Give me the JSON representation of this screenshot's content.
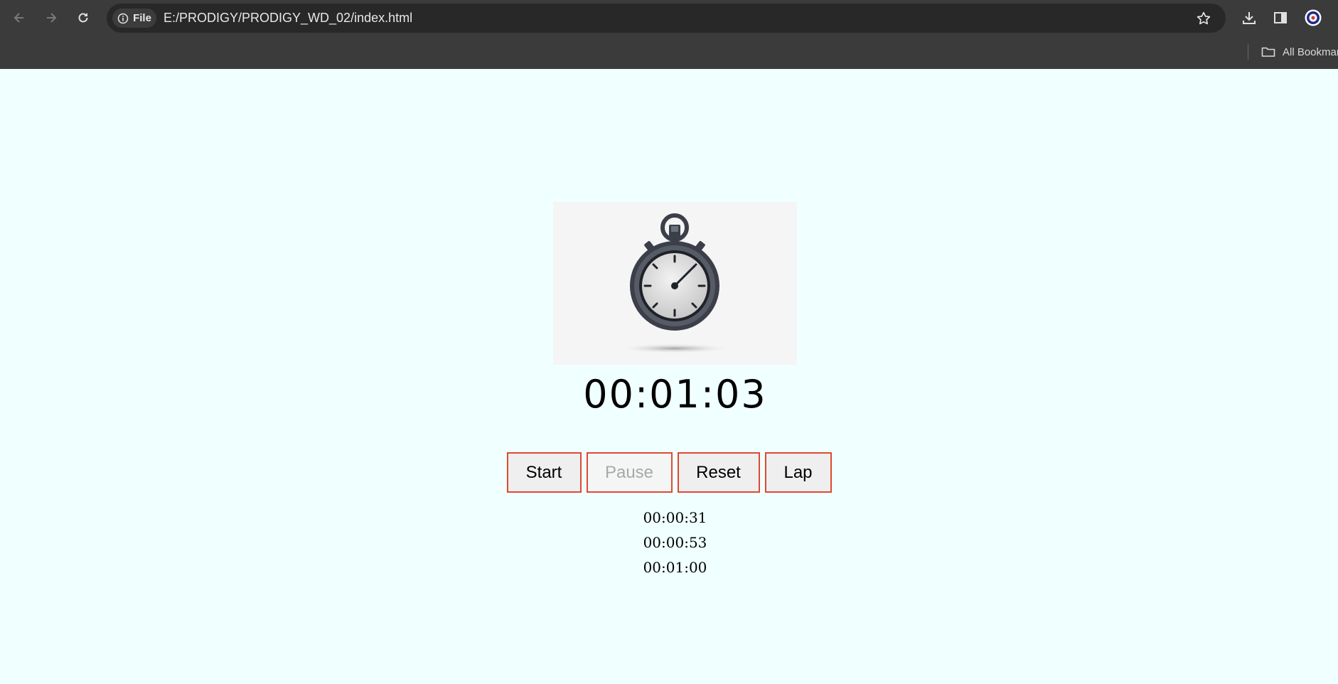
{
  "browser": {
    "file_chip_label": "File",
    "url": "E:/PRODIGY/PRODIGY_WD_02/index.html",
    "bookmarks_label": "All Bookmarks"
  },
  "stopwatch": {
    "display": "00:01:03",
    "buttons": {
      "start": "Start",
      "pause": "Pause",
      "reset": "Reset",
      "lap": "Lap"
    },
    "pause_disabled": true,
    "laps": [
      "00:00:31",
      "00:00:53",
      "00:01:00"
    ]
  },
  "colors": {
    "page_background": "#f0ffff",
    "button_border": "#e0492f",
    "chrome_background": "#3b3b3b"
  }
}
